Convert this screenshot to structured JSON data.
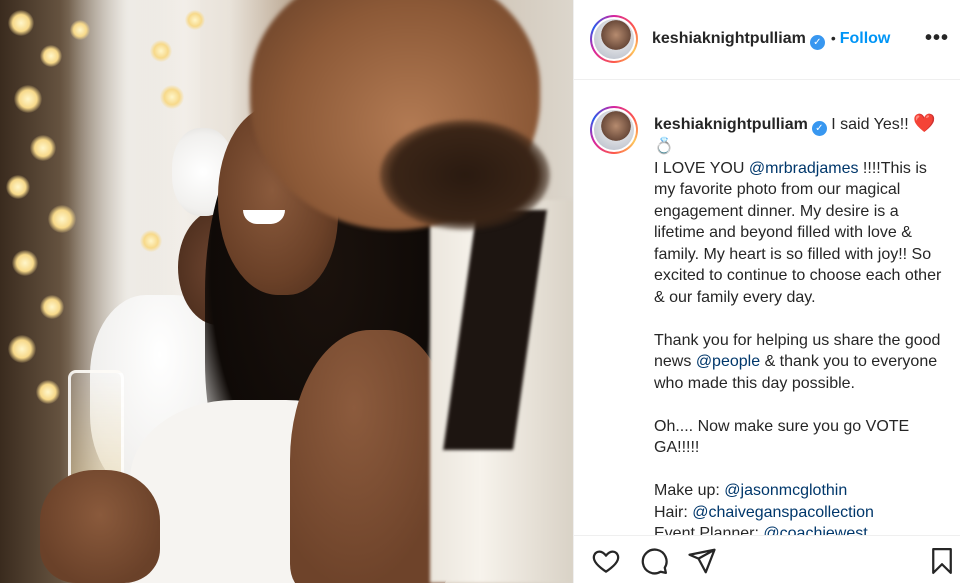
{
  "post": {
    "username": "keshiaknightpulliam",
    "verified_icon": "verified-badge-icon",
    "separator": "•",
    "follow_label": "Follow",
    "more_label": "•••"
  },
  "caption": {
    "username": "keshiaknightpulliam",
    "paragraph1": {
      "intro": "I said Yes!!",
      "heart": "❤️",
      "ring": "💍",
      "line_a": "I LOVE YOU",
      "mention_a": "@mrbradjames",
      "line_b": "!!!!This is my favorite photo from our magical engagement dinner. My desire is a lifetime and beyond filled with love & family. My heart is so filled with joy!! So excited to continue to choose each other & our family every day."
    },
    "paragraph2": {
      "line_a": "Thank you for helping us share the good news",
      "mention_a": "@people",
      "line_b": "& thank you to everyone who made this day possible."
    },
    "paragraph3": "Oh.... Now make sure you go VOTE GA!!!!!",
    "credits": [
      {
        "label": "Make up:",
        "mention": "@jasonmcglothin"
      },
      {
        "label": "Hair:",
        "mention": "@chaiveganspacollection"
      },
      {
        "label": "Event Planner:",
        "mention": "@coachjewest"
      }
    ]
  },
  "actions": {
    "like_icon": "heart-icon",
    "comment_icon": "comment-icon",
    "share_icon": "share-icon",
    "save_icon": "bookmark-icon"
  },
  "colors": {
    "link_blue": "#0095f6",
    "mention_blue": "#00376b",
    "verified_blue": "#3897f0",
    "text": "#262626",
    "divider": "#efefef"
  }
}
